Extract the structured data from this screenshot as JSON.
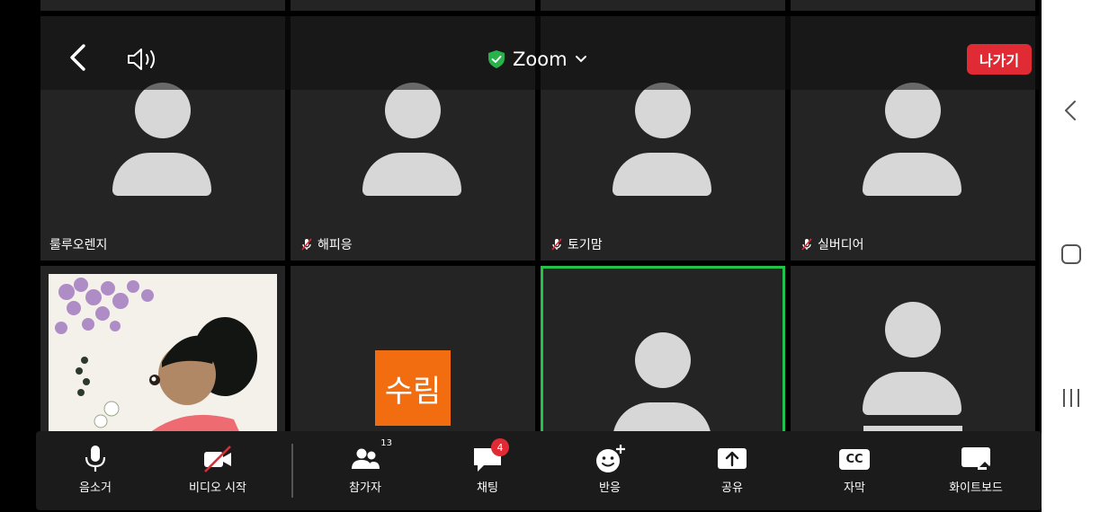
{
  "header": {
    "title": "Zoom",
    "leave_label": "나가기",
    "secure_color": "#27b24a",
    "leave_color": "#e02b35"
  },
  "participants": [
    {
      "name": "룰루오렌지",
      "muted": false
    },
    {
      "name": "해피응",
      "muted": true
    },
    {
      "name": "토기맘",
      "muted": true
    },
    {
      "name": "실버디어",
      "muted": true
    },
    {
      "name": "",
      "type": "video"
    },
    {
      "name": "",
      "initial": "수림",
      "initial_color": "#f26d10"
    },
    {
      "name": "",
      "active": true,
      "active_color": "#22c24b"
    },
    {
      "name": ""
    }
  ],
  "toolbar": {
    "mute_label": "음소거",
    "video_label": "비디오 시작",
    "participants_label": "참가자",
    "participants_count": "13",
    "chat_label": "채팅",
    "chat_badge": "4",
    "reactions_label": "반응",
    "share_label": "공유",
    "captions_label": "자막",
    "captions_icon_text": "CC",
    "whiteboard_label": "화이트보드"
  },
  "system_nav": {
    "icons": [
      "back-icon",
      "home-icon",
      "recents-icon"
    ]
  }
}
